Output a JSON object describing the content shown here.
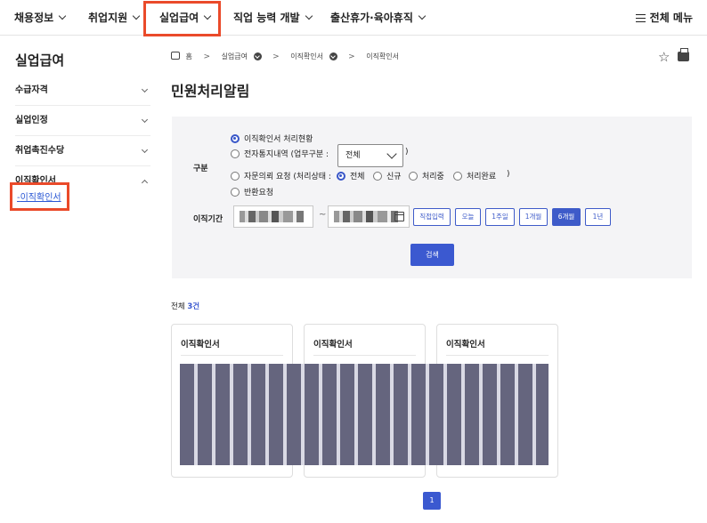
{
  "nav": {
    "items": [
      "채용정보",
      "취업지원",
      "실업급여",
      "직업 능력 개발",
      "출산휴가·육아휴직"
    ],
    "all_menu": "전체 메뉴",
    "highlighted": "실업급여",
    "highlight_color": "#ea4a2a"
  },
  "sidebar": {
    "title": "실업급여",
    "items": [
      "수급자격",
      "실업인정",
      "취업촉진수당",
      "이직확인서"
    ],
    "sub_item": "이직확인서"
  },
  "breadcrumb": {
    "home": "홈",
    "level1": "실업급여",
    "level2": "이직확인서",
    "level3": "이직확인서"
  },
  "page": {
    "title": "민원처리알림"
  },
  "search": {
    "category_label": "구분",
    "radio_status": "이직확인서 처리현황",
    "radio_notice": "전자통지내역 (업무구분 :",
    "notice_close": ")",
    "select_value": "전체",
    "radio_consult": "자문의뢰 요청 (처리상태 :",
    "consult_options": [
      "전체",
      "신규",
      "처리중",
      "처리완료"
    ],
    "consult_close": ")",
    "radio_return": "반환요청",
    "period_label": "이직기간",
    "tilde": "~",
    "period_buttons": [
      "직접입력",
      "오늘",
      "1주일",
      "1개월",
      "6개월",
      "1년"
    ],
    "active_period": "6개월",
    "search_button": "검색"
  },
  "results": {
    "total_prefix": "전체",
    "count": "3건",
    "cards": [
      "이직확인서",
      "이직확인서",
      "이직확인서"
    ]
  },
  "pagination": {
    "current": "1"
  },
  "colors": {
    "accent": "#3b59d0"
  }
}
